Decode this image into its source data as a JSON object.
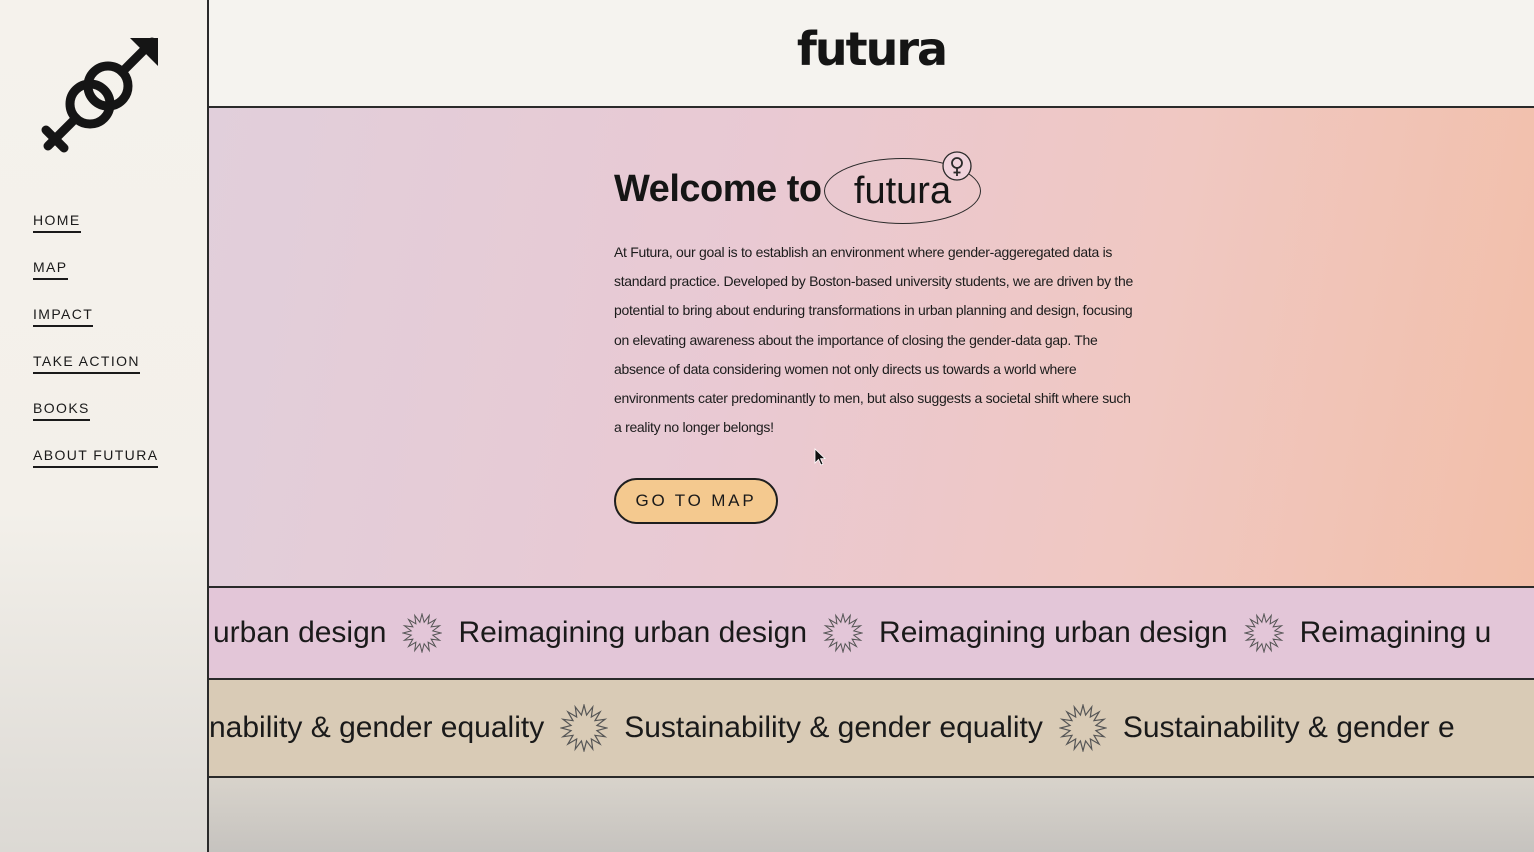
{
  "sidebar": {
    "logo_icon": "gender-symbol-icon",
    "nav": [
      {
        "label": "HOME"
      },
      {
        "label": "MAP"
      },
      {
        "label": "IMPACT"
      },
      {
        "label": "TAKE ACTION"
      },
      {
        "label": "BOOKS"
      },
      {
        "label": "ABOUT FUTURA"
      }
    ]
  },
  "header": {
    "brand": "futura"
  },
  "hero": {
    "welcome": "Welcome to",
    "oval_word": "futura",
    "pin_icon": "female-symbol-icon",
    "intro": "At Futura, our goal is to establish an environment where gender-aggeregated data is standard practice. Developed by Boston-based university students, we are driven by the potential to bring about enduring transformations in urban planning and design, focusing on elevating awareness about the importance of closing the gender-data gap. The absence of data considering women not only directs us towards a world where environments cater predominantly to men, but also suggests a societal shift where such a reality no longer belongs!",
    "cta": "GO TO MAP"
  },
  "marquee": {
    "row1": [
      "urban design",
      "Reimagining urban design",
      "Reimagining urban design",
      "Reimagining u"
    ],
    "row2": [
      "nability & gender equality",
      "Sustainability & gender equality",
      "Sustainability & gender e"
    ]
  },
  "colors": {
    "accent_button": "#f4c98f",
    "band1": "#e3c6d8",
    "band2": "#d9cbb6"
  }
}
